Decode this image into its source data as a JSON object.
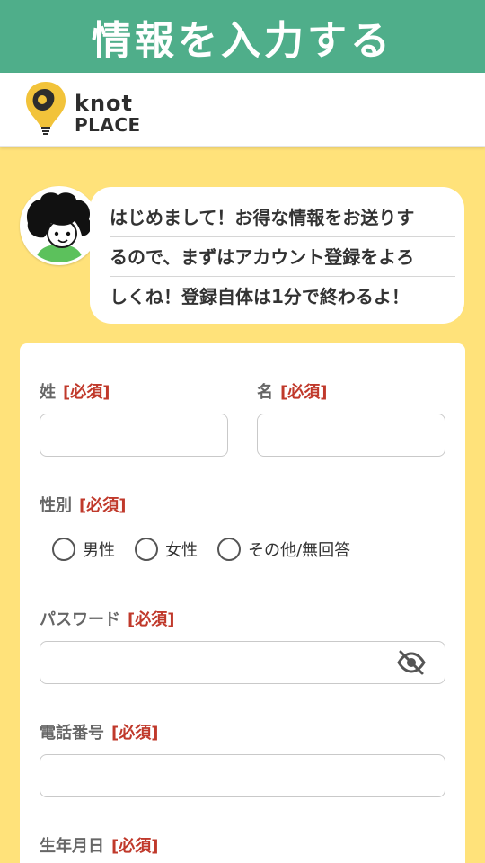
{
  "banner": {
    "title": "情報を入力する"
  },
  "logo": {
    "line1": "knot",
    "line2": "PLACE"
  },
  "colors": {
    "banner": "#4fae8a",
    "background": "#ffe27a",
    "required": "#c0392b",
    "logo_pin": "#f2c33a"
  },
  "greeting": {
    "lines": [
      "はじめまして！お得な情報をお送りす",
      "るので、まずはアカウント登録をよろ",
      "しくね！登録自体は1分で終わるよ！"
    ]
  },
  "form": {
    "required_tag": "[必須]",
    "last_name": {
      "label": "姓",
      "value": ""
    },
    "first_name": {
      "label": "名",
      "value": ""
    },
    "gender": {
      "label": "性別",
      "options": [
        "男性",
        "女性",
        "その他/無回答"
      ]
    },
    "password": {
      "label": "パスワード",
      "value": "",
      "toggle_icon": "eye-off-icon"
    },
    "phone": {
      "label": "電話番号",
      "value": ""
    },
    "birthdate": {
      "label": "生年月日"
    }
  }
}
